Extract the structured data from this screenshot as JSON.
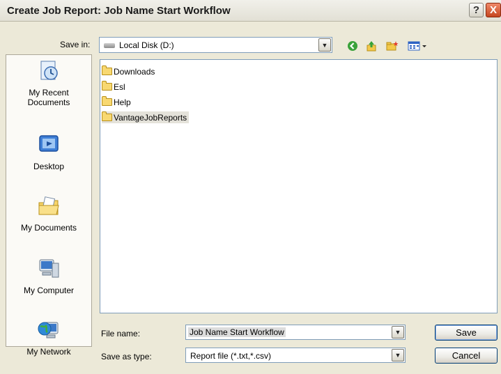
{
  "dialog": {
    "title": "Create Job Report: Job Name Start Workflow",
    "help_glyph": "?",
    "close_glyph": "X"
  },
  "save_in": {
    "label": "Save in:",
    "value": "Local Disk (D:)"
  },
  "toolbar": {
    "icons": [
      "back-icon",
      "up-folder-icon",
      "new-folder-icon",
      "view-menu-icon"
    ]
  },
  "places": [
    {
      "label_line1": "My Recent",
      "label_line2": "Documents",
      "icon": "recent-documents-icon"
    },
    {
      "label_line1": "Desktop",
      "label_line2": "",
      "icon": "desktop-icon"
    },
    {
      "label_line1": "My Documents",
      "label_line2": "",
      "icon": "my-documents-icon"
    },
    {
      "label_line1": "My Computer",
      "label_line2": "",
      "icon": "my-computer-icon"
    },
    {
      "label_line1": "My Network",
      "label_line2": "",
      "icon": "my-network-icon"
    }
  ],
  "files": [
    {
      "name": "Downloads"
    },
    {
      "name": "Esl"
    },
    {
      "name": "Help"
    },
    {
      "name": "VantageJobReports"
    }
  ],
  "file_name": {
    "label": "File name:",
    "value": "Job Name Start Workflow"
  },
  "save_as_type": {
    "label": "Save as type:",
    "value": "Report file (*.txt,*.csv)"
  },
  "buttons": {
    "save": "Save",
    "cancel": "Cancel"
  },
  "colors": {
    "dialog_bg": "#ece9d8",
    "selection_bg": "#e4e2da",
    "input_border": "#7f9db9"
  }
}
